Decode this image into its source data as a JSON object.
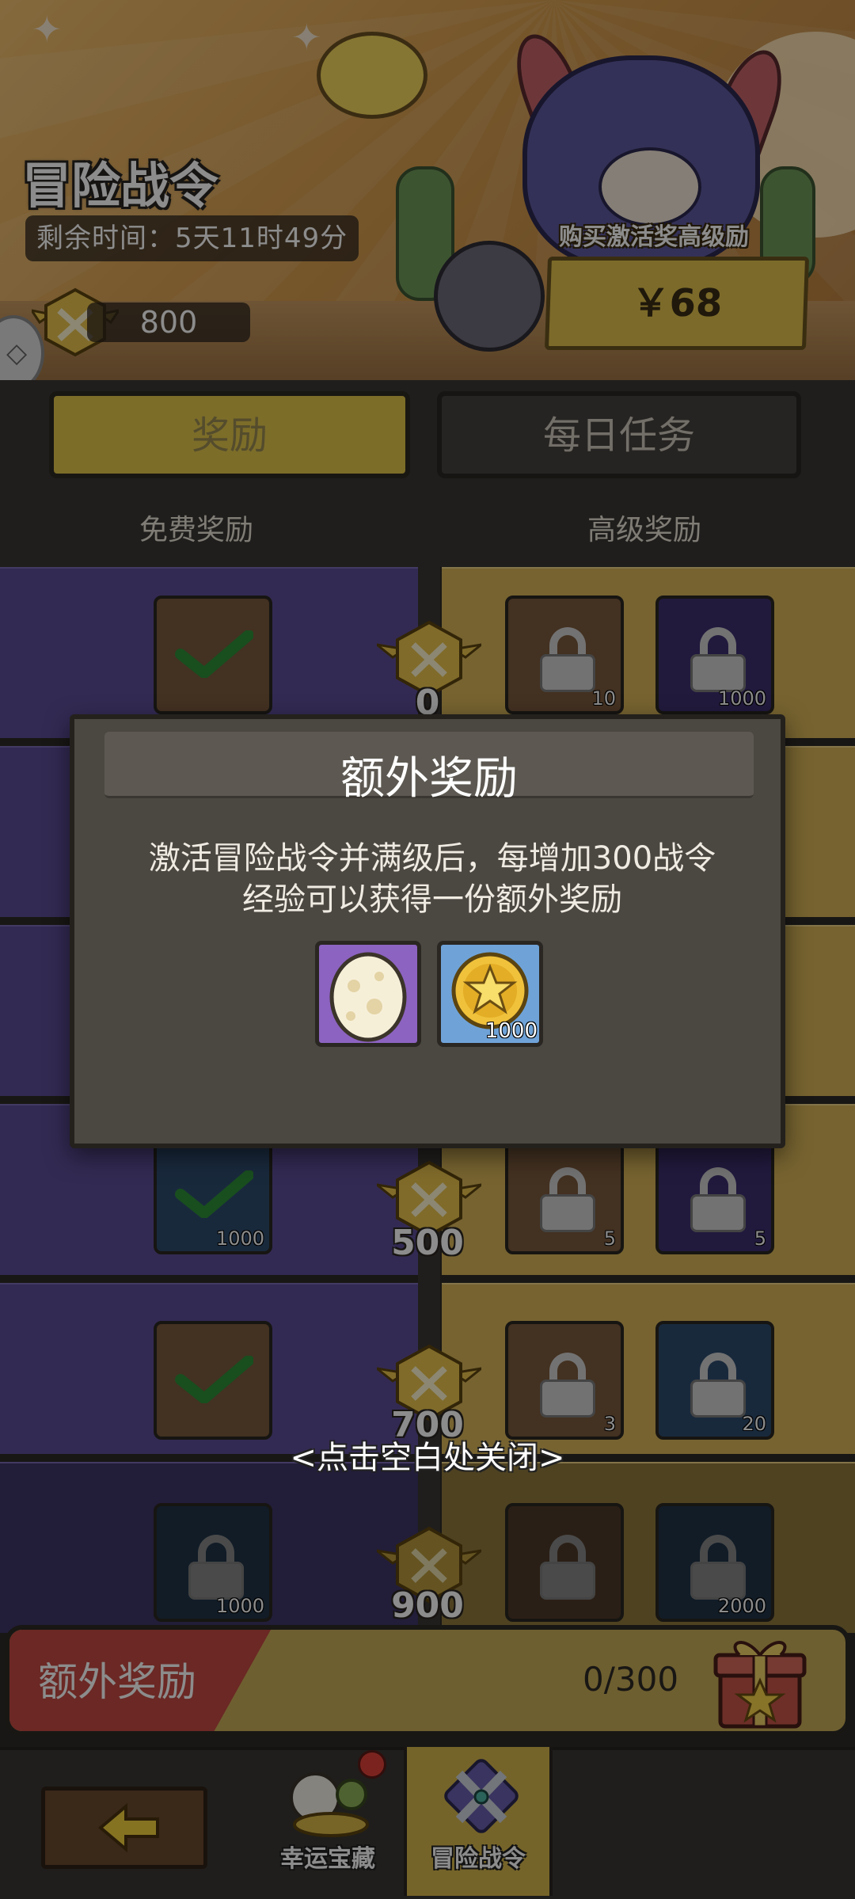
{
  "header": {
    "title": "冒险战令",
    "time_remaining": "剩余时间：5天11时49分",
    "pass_points": "800",
    "buy_label": "购买激活奖高级励",
    "buy_price": "￥68"
  },
  "tabs": [
    {
      "label": "奖励",
      "active": true
    },
    {
      "label": "每日任务",
      "active": false
    }
  ],
  "columns": {
    "free": "免费奖励",
    "premium": "高级奖励"
  },
  "track": {
    "visible_levels": [
      "0",
      "500",
      "700",
      "900"
    ],
    "rows": [
      {
        "level": "0",
        "free": {
          "icon": "clover",
          "claimed": true
        },
        "premium": [
          {
            "icon": "gold-s",
            "count": "10",
            "locked": true
          },
          {
            "icon": "purple-crystal",
            "count": "1000",
            "locked": true
          }
        ]
      },
      {
        "level": "500",
        "free": {
          "icon": "coin",
          "count": "1000",
          "claimed": true
        },
        "premium": [
          {
            "icon": "gold-s",
            "count": "5",
            "locked": true
          },
          {
            "icon": "egg",
            "count": "5",
            "locked": true
          }
        ]
      },
      {
        "level": "700",
        "free": {
          "icon": "clover",
          "claimed": true
        },
        "premium": [
          {
            "icon": "clover",
            "count": "3",
            "locked": true
          },
          {
            "icon": "scroll",
            "count": "20",
            "locked": true
          }
        ]
      },
      {
        "level": "900",
        "free": {
          "icon": "coin",
          "count": "1000",
          "locked": true
        },
        "premium": [
          {
            "icon": "egg",
            "locked": true
          },
          {
            "icon": "coin",
            "count": "2000",
            "locked": true
          }
        ]
      }
    ]
  },
  "modal": {
    "title": "额外奖励",
    "body_line1": "激活冒险战令并满级后，每增加300战令",
    "body_line2": "经验可以获得一份额外奖励",
    "rewards": [
      {
        "icon": "egg",
        "count": ""
      },
      {
        "icon": "star-coin",
        "count": "1000"
      }
    ],
    "close_hint": "<点击空白处关闭>"
  },
  "extra_bar": {
    "label": "额外奖励",
    "progress": "0/300"
  },
  "bottom_nav": {
    "back_icon": "back-arrow-icon",
    "tabs": [
      {
        "label": "幸运宝藏",
        "has_notification": true
      },
      {
        "label": "冒险战令",
        "active": true
      }
    ]
  },
  "colors": {
    "free_column": "#5e4d98",
    "premium_column": "#d7b458",
    "accent_yellow": "#e2c64b",
    "extra_red": "#c44a42"
  }
}
